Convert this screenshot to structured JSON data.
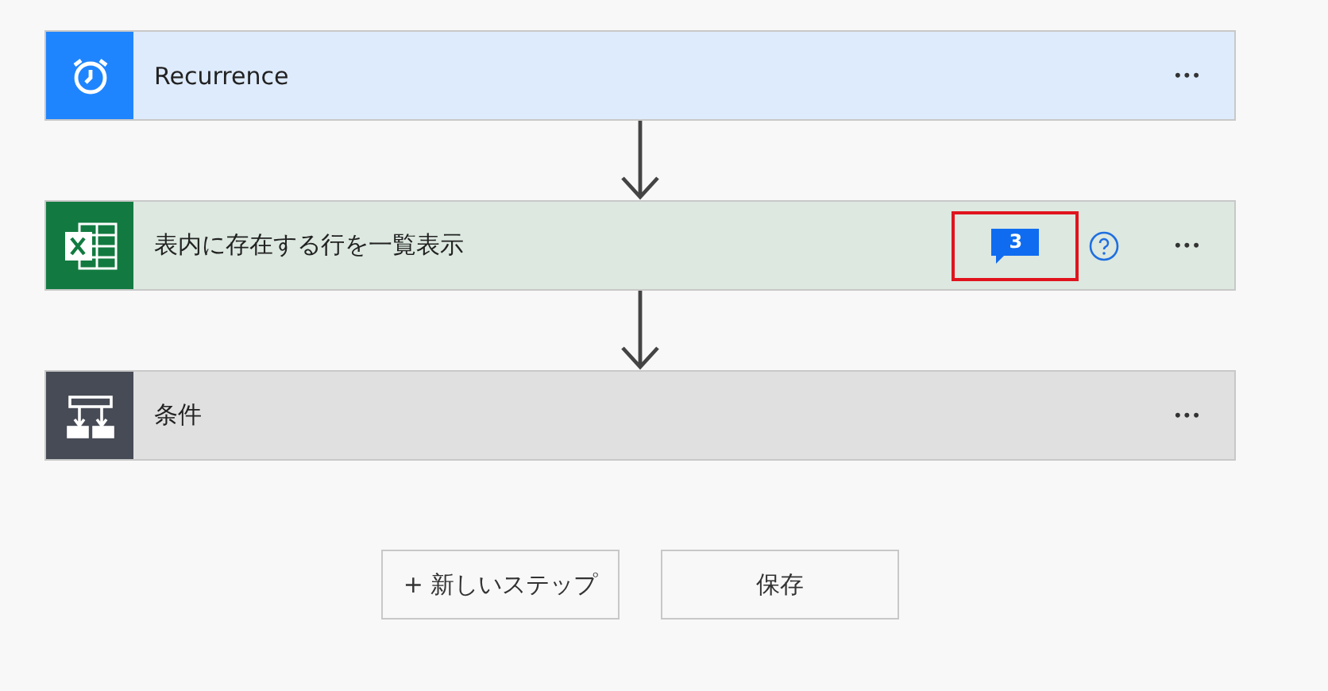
{
  "steps": [
    {
      "kind": "recurrence",
      "title": "Recurrence",
      "help": false,
      "menu": "•••"
    },
    {
      "kind": "excel",
      "title": "表内に存在する行を一覧表示",
      "help": true,
      "comments": {
        "count": "3",
        "highlighted": true
      },
      "menu": "•••"
    },
    {
      "kind": "condition",
      "title": "条件",
      "help": false,
      "menu": "•••"
    }
  ],
  "buttons": [
    {
      "label": "+ 新しいステップ"
    },
    {
      "label": "保存"
    }
  ]
}
